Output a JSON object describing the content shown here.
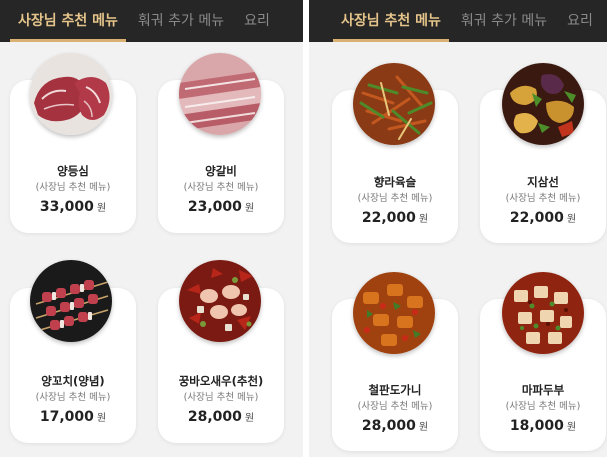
{
  "screens": [
    {
      "tabs": [
        {
          "label": "사장님 추천 메뉴",
          "active": true
        },
        {
          "label": "훠궈 추가 메뉴",
          "active": false
        },
        {
          "label": "요리",
          "active": false
        }
      ],
      "items": [
        {
          "name": "양등심",
          "sub": "(사장님 추천 메뉴)",
          "price": "33,000",
          "unit": "원",
          "photo": "lamb-loin-photo"
        },
        {
          "name": "양갈비",
          "sub": "(사장님 추천 메뉴)",
          "price": "23,000",
          "unit": "원",
          "photo": "lamb-rib-photo"
        },
        {
          "name": "양꼬치(양념)",
          "sub": "(사장님 추천 메뉴)",
          "price": "17,000",
          "unit": "원",
          "photo": "lamb-skewer-photo"
        },
        {
          "name": "꿍바오새우(추천)",
          "sub": "(사장님 추천 메뉴)",
          "price": "28,000",
          "unit": "원",
          "photo": "kung-pao-shrimp-photo"
        }
      ]
    },
    {
      "tabs": [
        {
          "label": "사장님 추천 메뉴",
          "active": true
        },
        {
          "label": "훠궈 추가 메뉴",
          "active": false
        },
        {
          "label": "요리",
          "active": false
        }
      ],
      "items": [
        {
          "name": "향라육슬",
          "sub": "(사장님 추천 메뉴)",
          "price": "22,000",
          "unit": "원",
          "photo": "spicy-shredded-pork-photo"
        },
        {
          "name": "지삼선",
          "sub": "(사장님 추천 메뉴)",
          "price": "22,000",
          "unit": "원",
          "photo": "di-san-xian-photo"
        },
        {
          "name": "철판도가니",
          "sub": "(사장님 추천 메뉴)",
          "price": "28,000",
          "unit": "원",
          "photo": "iron-plate-tendon-photo"
        },
        {
          "name": "마파두부",
          "sub": "(사장님 추천 메뉴)",
          "price": "18,000",
          "unit": "원",
          "photo": "mapo-tofu-photo"
        }
      ]
    }
  ],
  "colors": {
    "tabbar_bg": "#262626",
    "active_tab": "#e4c48a",
    "inactive_tab": "#8a8a8a",
    "page_bg": "#f2f2f2",
    "card_bg": "#ffffff"
  }
}
